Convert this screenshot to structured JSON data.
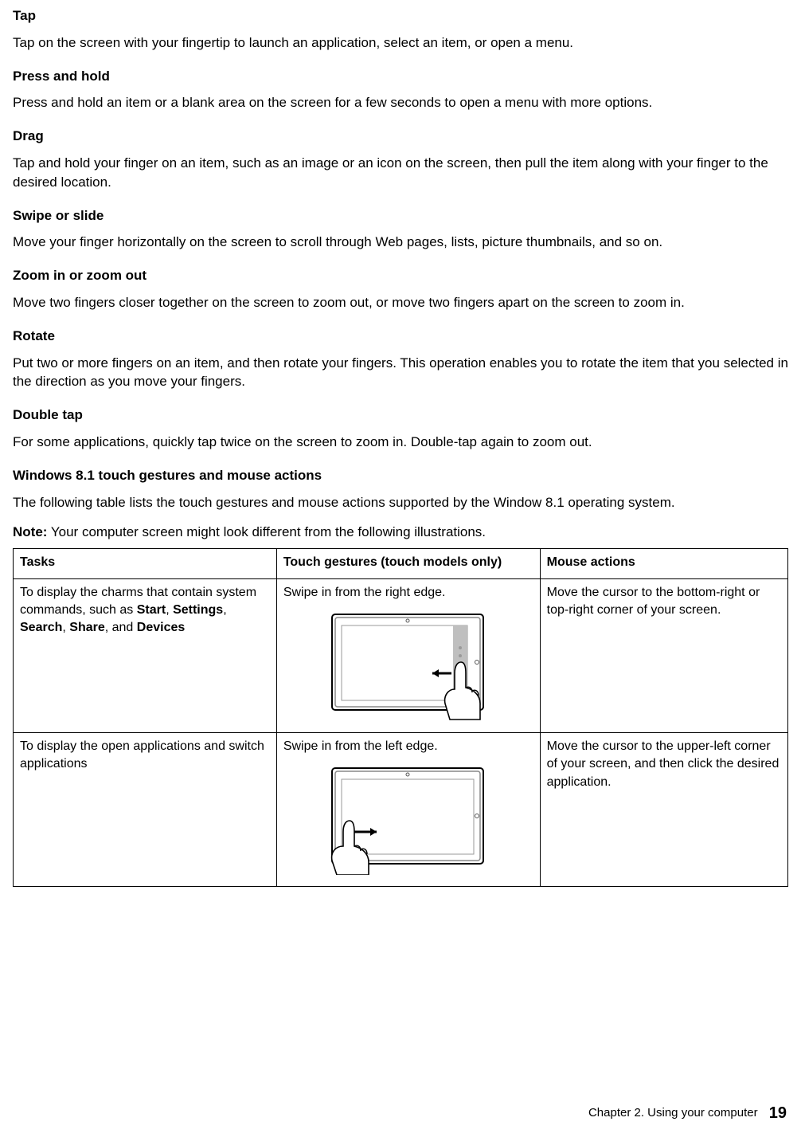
{
  "sections": {
    "tap": {
      "heading": "Tap",
      "text": "Tap on the screen with your fingertip to launch an application, select an item, or open a menu."
    },
    "press_hold": {
      "heading": "Press and hold",
      "text": "Press and hold an item or a blank area on the screen for a few seconds to open a menu with more options."
    },
    "drag": {
      "heading": "Drag",
      "text": "Tap and hold your finger on an item, such as an image or an icon on the screen, then pull the item along with your finger to the desired location."
    },
    "swipe": {
      "heading": "Swipe or slide",
      "text": "Move your finger horizontally on the screen to scroll through Web pages, lists, picture thumbnails, and so on."
    },
    "zoom": {
      "heading": "Zoom in or zoom out",
      "text": "Move two fingers closer together on the screen to zoom out, or move two fingers apart on the screen to zoom in."
    },
    "rotate": {
      "heading": "Rotate",
      "text": "Put two or more fingers on an item, and then rotate your fingers. This operation enables you to rotate the item that you selected in the direction as you move your fingers."
    },
    "double_tap": {
      "heading": "Double tap",
      "text": "For some applications, quickly tap twice on the screen to zoom in. Double-tap again to zoom out."
    },
    "win81": {
      "heading": "Windows 8.1 touch gestures and mouse actions",
      "text": "The following table lists the touch gestures and mouse actions supported by the Window 8.1 operating system."
    }
  },
  "note": {
    "label": "Note:",
    "text": " Your computer screen might look different from the following illustrations."
  },
  "table": {
    "headers": {
      "tasks": "Tasks",
      "touch": "Touch gestures (touch models only)",
      "mouse": "Mouse actions"
    },
    "rows": [
      {
        "task_pre": "To display the charms that contain system commands, such as ",
        "task_bold_parts": [
          "Start",
          "Settings",
          "Search",
          "Share",
          "Devices"
        ],
        "task_joiners": [
          ", ",
          ", ",
          ", ",
          ", and "
        ],
        "touch": "Swipe in from the right edge.",
        "mouse": "Move the cursor to the bottom-right or top-right corner of your screen."
      },
      {
        "task_plain": "To display the open applications and switch applications",
        "touch": "Swipe in from the left edge.",
        "mouse": "Move the cursor to the upper-left corner of your screen, and then click the desired application."
      }
    ]
  },
  "footer": {
    "chapter": "Chapter 2.  Using your computer",
    "page": "19"
  }
}
